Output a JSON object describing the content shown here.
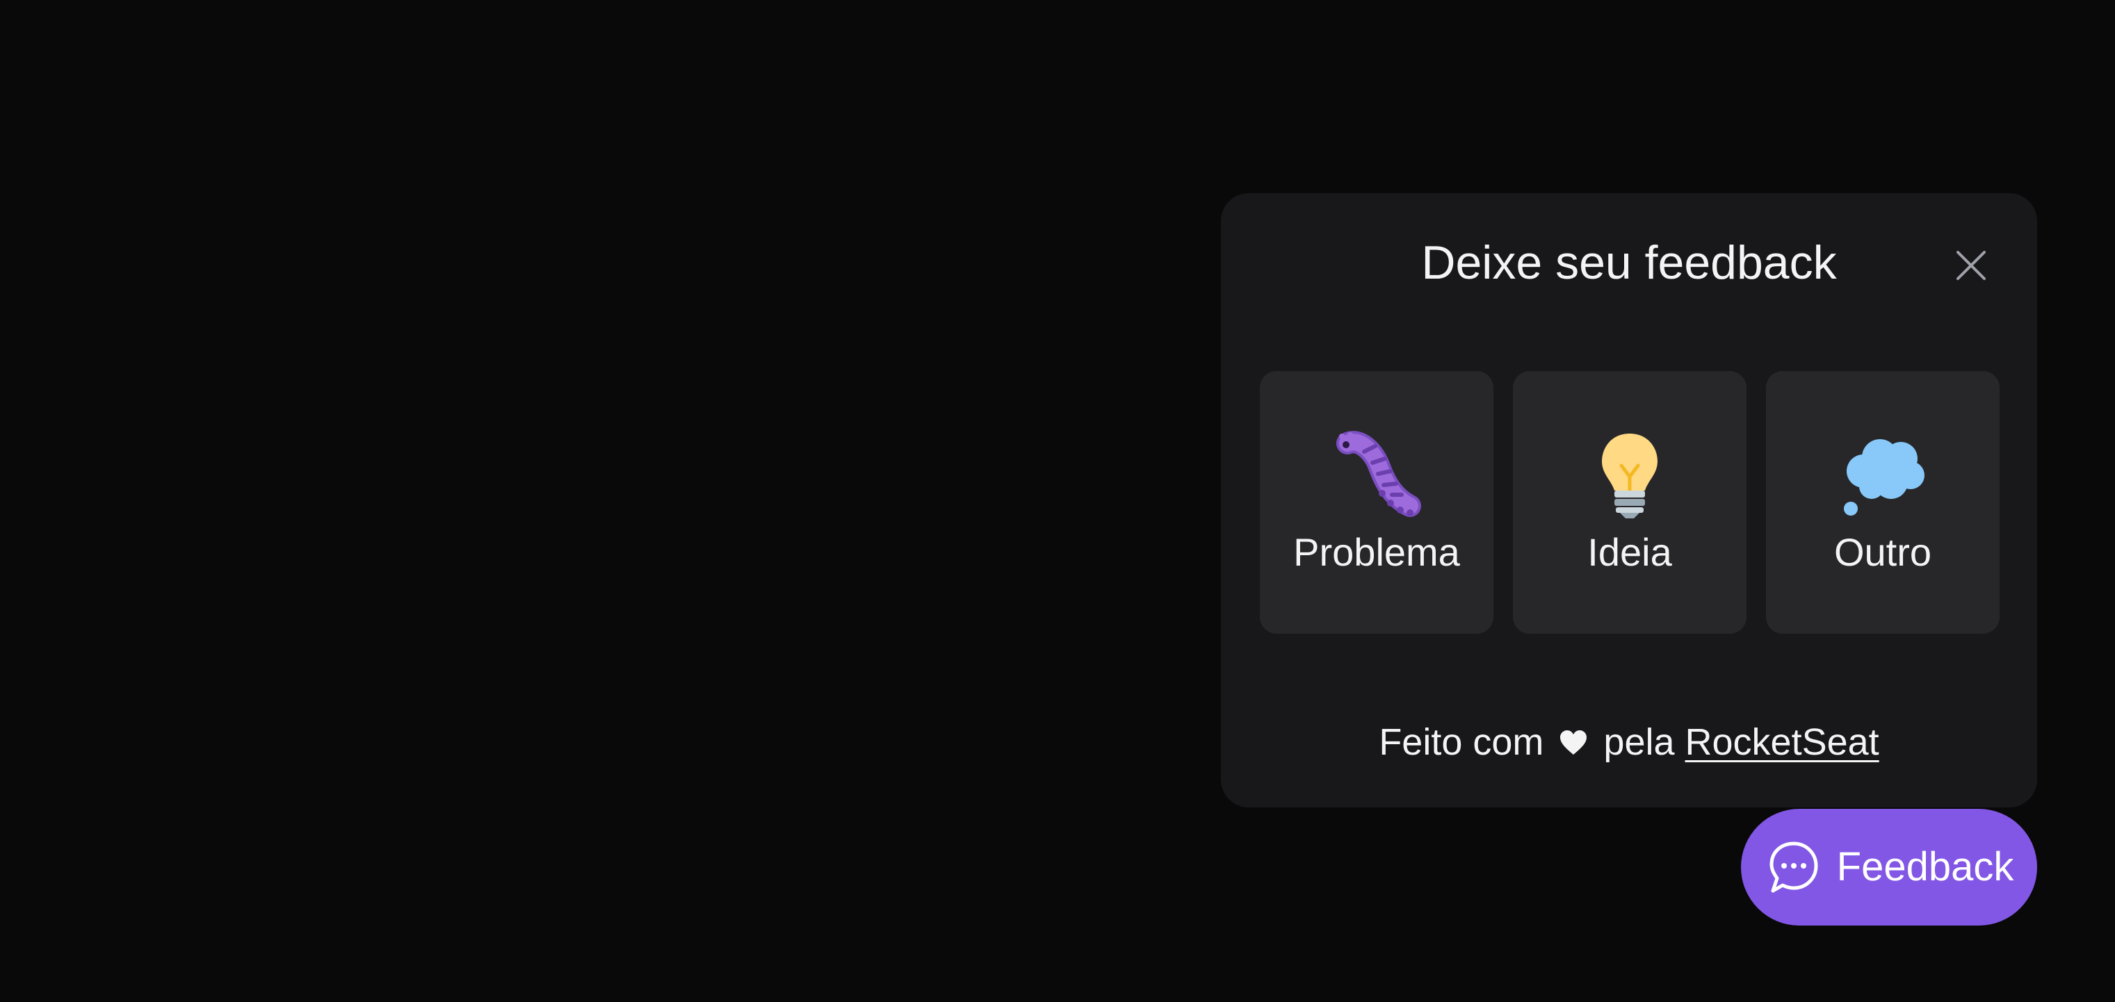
{
  "widget": {
    "title": "Deixe seu feedback",
    "close_icon": "close-icon",
    "types": [
      {
        "label": "Problema",
        "icon": "bug-icon"
      },
      {
        "label": "Ideia",
        "icon": "lightbulb-icon"
      },
      {
        "label": "Outro",
        "icon": "thought-balloon-icon"
      }
    ],
    "footer": {
      "prefix": "Feito com",
      "heart_icon": "heart-icon",
      "middle": "pela",
      "link_text": "RocketSeat"
    }
  },
  "fab": {
    "label": "Feedback",
    "icon": "chat-bubble-icon"
  },
  "colors": {
    "background": "#09090a",
    "surface": "#18181b",
    "card": "#27272a",
    "text": "#f4f4f5",
    "brand": "#8257e5",
    "muted": "#a1a1aa"
  }
}
